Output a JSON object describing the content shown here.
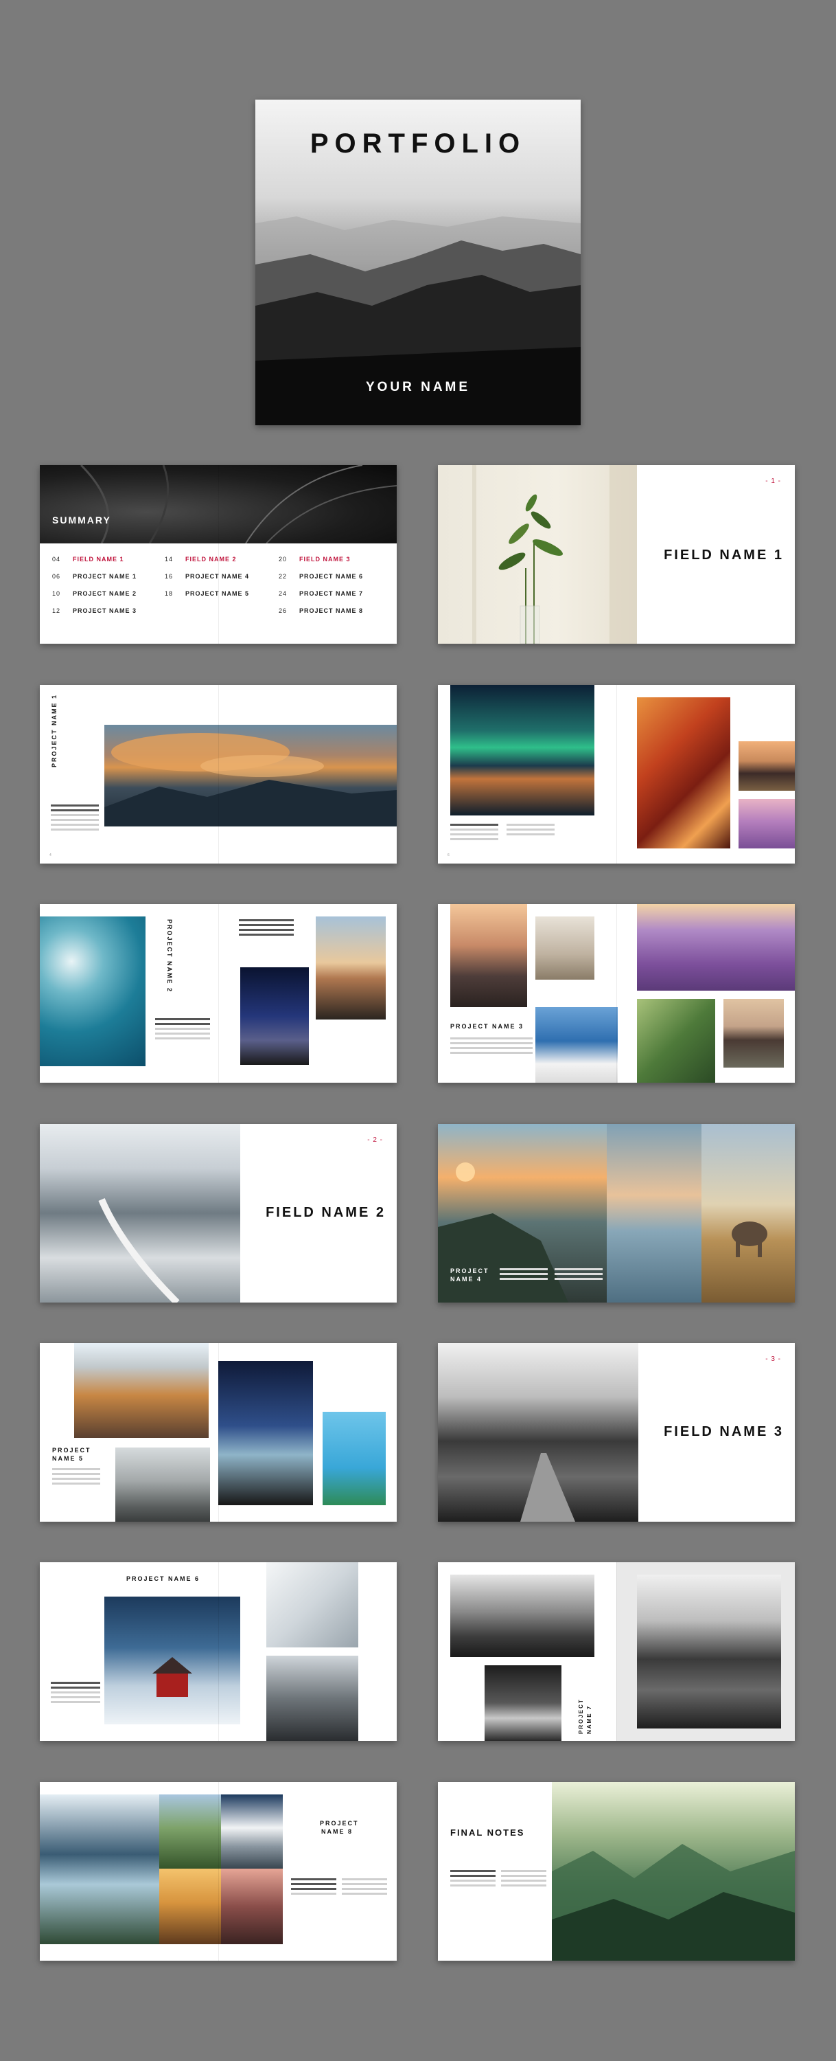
{
  "cover": {
    "title": "PORTFOLIO",
    "name": "YOUR NAME"
  },
  "summary": {
    "heading": "SUMMARY",
    "entries": [
      {
        "num": "04",
        "label": "FIELD NAME 1",
        "highlight": true
      },
      {
        "num": "06",
        "label": "PROJECT NAME 1"
      },
      {
        "num": "10",
        "label": "PROJECT NAME 2"
      },
      {
        "num": "12",
        "label": "PROJECT NAME 3"
      },
      {
        "num": "14",
        "label": "FIELD NAME 2",
        "highlight": true
      },
      {
        "num": "16",
        "label": "PROJECT NAME 4"
      },
      {
        "num": "18",
        "label": "PROJECT NAME 5"
      },
      {
        "num": "20",
        "label": "FIELD NAME 3",
        "highlight": true
      },
      {
        "num": "22",
        "label": "PROJECT NAME 6"
      },
      {
        "num": "24",
        "label": "PROJECT NAME 7"
      },
      {
        "num": "26",
        "label": "PROJECT NAME 8"
      }
    ]
  },
  "fields": [
    {
      "num": "- 1 -",
      "label": "FIELD NAME 1"
    },
    {
      "num": "- 2 -",
      "label": "FIELD NAME 2"
    },
    {
      "num": "- 3 -",
      "label": "FIELD NAME 3"
    }
  ],
  "projects": {
    "p1": "PROJECT NAME 1",
    "p2": "PROJECT NAME 2",
    "p3": "PROJECT NAME 3",
    "p4a": "PROJECT",
    "p4b": "NAME 4",
    "p5a": "PROJECT",
    "p5b": "NAME 5",
    "p6": "PROJECT NAME 6",
    "p7a": "PROJECT",
    "p7b": "NAME 7",
    "p8a": "PROJECT",
    "p8b": "NAME 8"
  },
  "final_notes": "FINAL NOTES",
  "colors": {
    "accent": "#c0143c",
    "background": "#7b7b7b"
  }
}
